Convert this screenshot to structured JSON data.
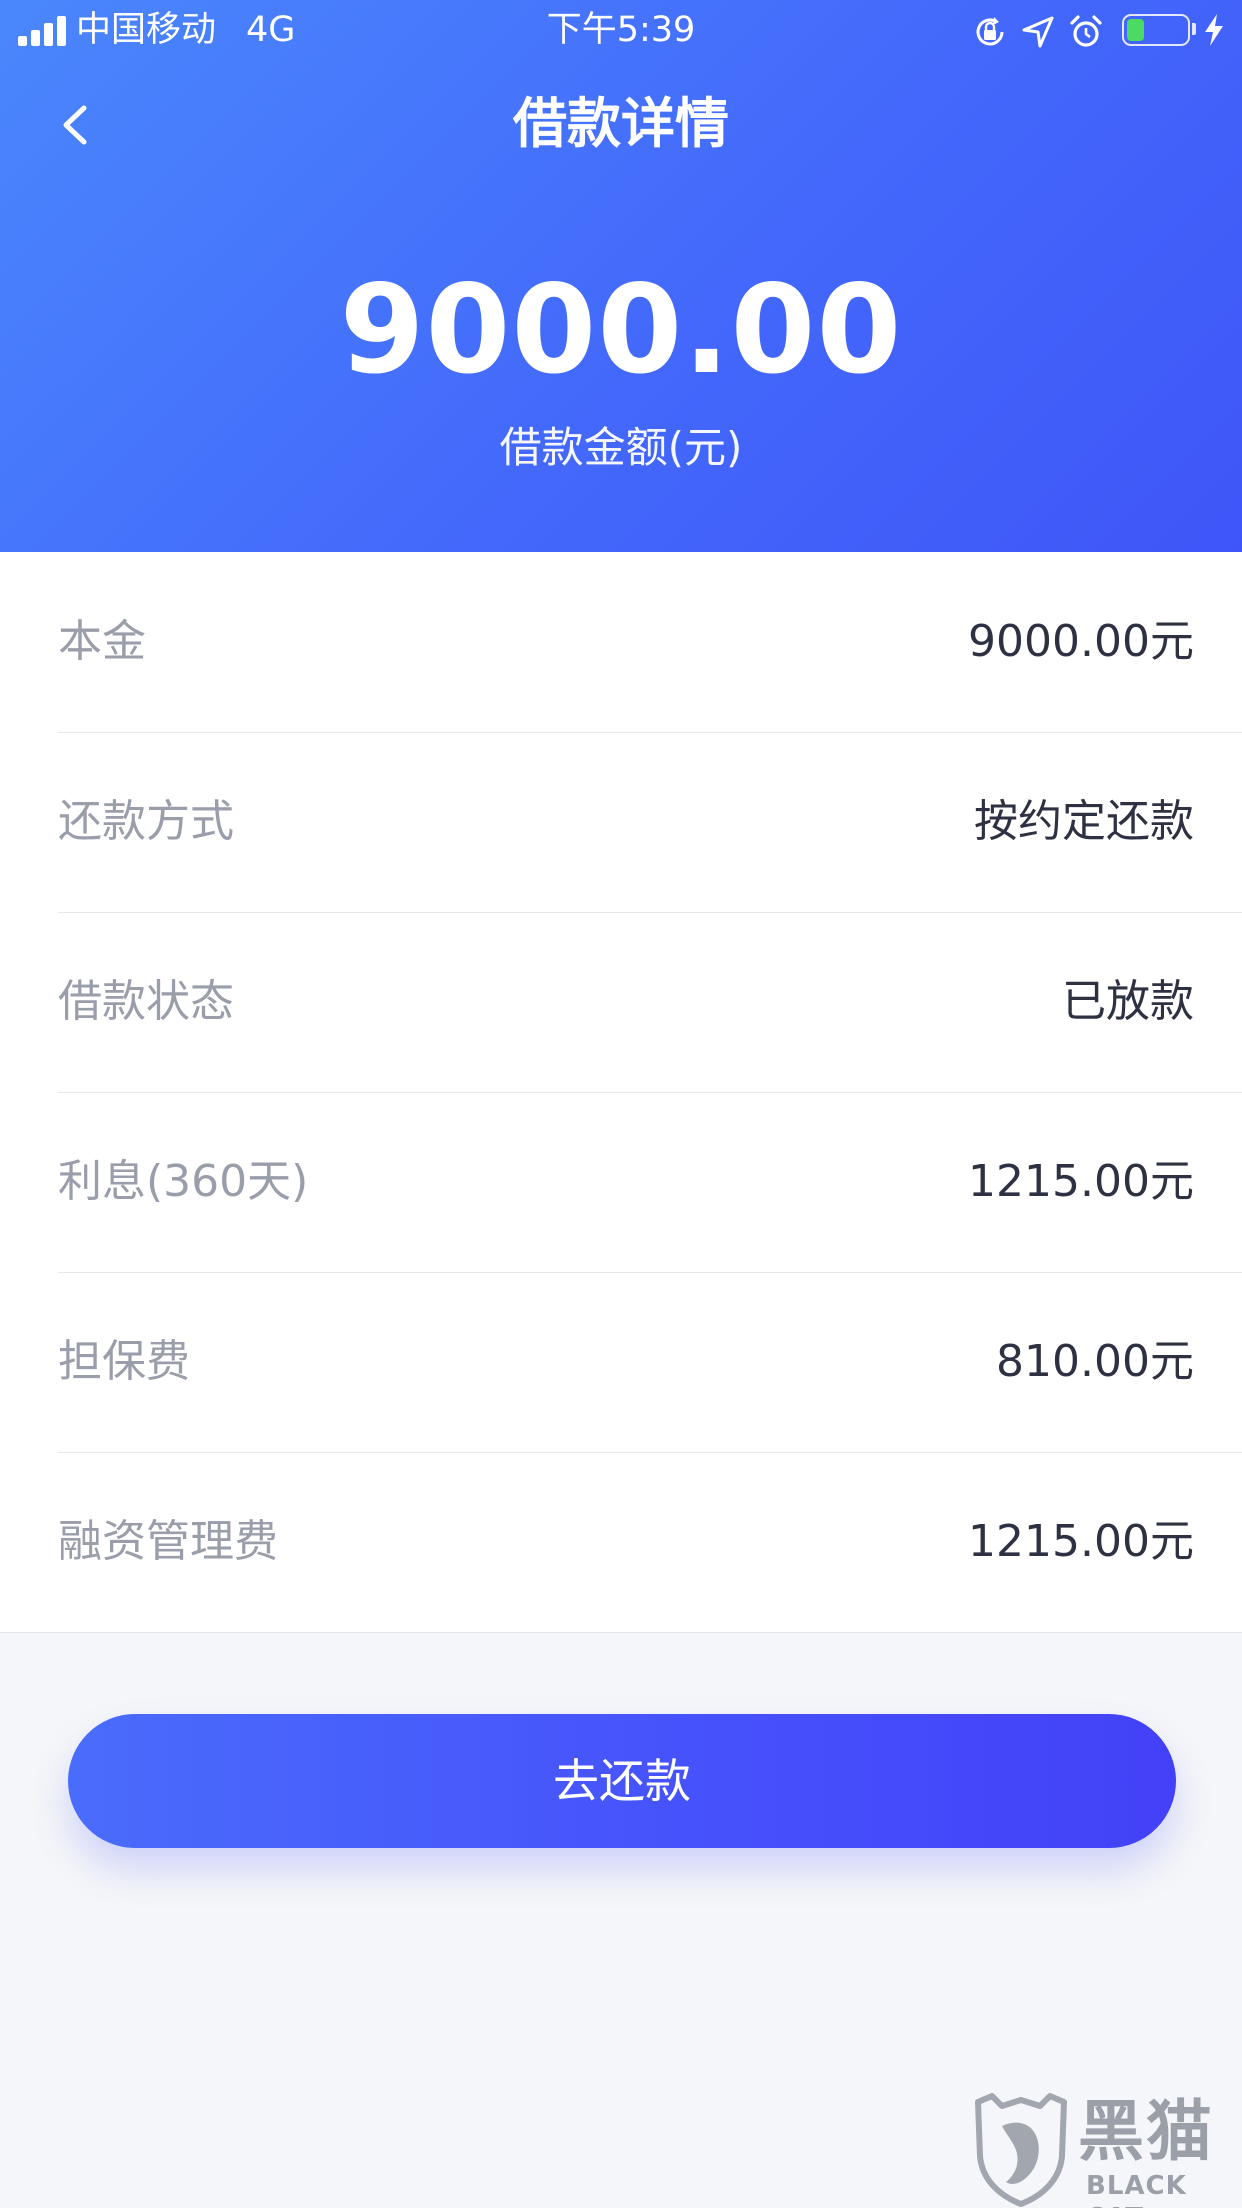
{
  "status_bar": {
    "carrier": "中国移动",
    "network": "4G",
    "time": "下午5:39",
    "battery_level": 0.3,
    "icons": [
      "signal-icon",
      "orientation-lock-icon",
      "location-icon",
      "alarm-icon",
      "battery-icon",
      "charging-icon"
    ]
  },
  "nav": {
    "title": "借款详情",
    "back_icon": "chevron-left-icon"
  },
  "summary": {
    "amount": "9000.00",
    "label": "借款金额(元)"
  },
  "details": [
    {
      "label": "本金",
      "value": "9000.00元"
    },
    {
      "label": "还款方式",
      "value": "按约定还款"
    },
    {
      "label": "借款状态",
      "value": "已放款"
    },
    {
      "label": "利息(360天)",
      "value": "1215.00元"
    },
    {
      "label": "担保费",
      "value": "810.00元"
    },
    {
      "label": "融资管理费",
      "value": "1215.00元"
    }
  ],
  "actions": {
    "repay_label": "去还款"
  },
  "watermark": {
    "brand": "黑猫",
    "sub": "BLACK CAT"
  },
  "colors": {
    "header_gradient_start": "#4a87fc",
    "header_gradient_end": "#3f55f8",
    "button_gradient_start": "#4a6cfb",
    "button_gradient_end": "#4341f8",
    "label_text": "#9a9eab",
    "value_text": "#2e3142",
    "page_background": "#f5f6f9",
    "battery_fill": "#4cd964"
  }
}
